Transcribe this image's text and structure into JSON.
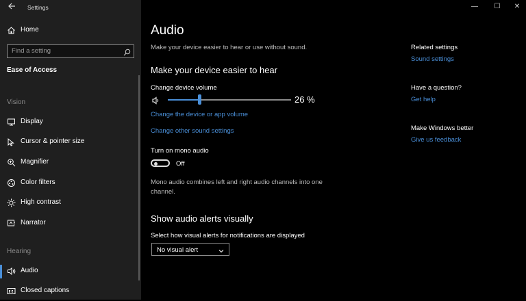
{
  "window": {
    "title": "Settings",
    "controls": {
      "minimize": "—",
      "maximize": "☐",
      "close": "✕"
    }
  },
  "sidebar": {
    "home_label": "Home",
    "search_placeholder": "Find a setting",
    "category_title": "Ease of Access",
    "sections": [
      {
        "heading": "Vision",
        "items": [
          {
            "label": "Display",
            "icon": "display-icon"
          },
          {
            "label": "Cursor & pointer size",
            "icon": "cursor-icon"
          },
          {
            "label": "Magnifier",
            "icon": "magnifier-icon"
          },
          {
            "label": "Color filters",
            "icon": "color-filters-icon"
          },
          {
            "label": "High contrast",
            "icon": "high-contrast-icon"
          },
          {
            "label": "Narrator",
            "icon": "narrator-icon"
          }
        ]
      },
      {
        "heading": "Hearing",
        "items": [
          {
            "label": "Audio",
            "icon": "speaker-icon",
            "active": true
          },
          {
            "label": "Closed captions",
            "icon": "closed-captions-icon"
          }
        ]
      }
    ]
  },
  "main": {
    "title": "Audio",
    "subtitle": "Make your device easier to hear or use without sound.",
    "hear_section": {
      "heading": "Make your device easier to hear",
      "volume_label": "Change device volume",
      "volume_percent": 26,
      "volume_text": "26 %",
      "link_app_volume": "Change the device or app volume",
      "link_sound_settings": "Change other sound settings",
      "mono_label": "Turn on mono audio",
      "mono_state": "Off",
      "mono_description": "Mono audio combines left and right audio channels into one channel."
    },
    "alerts_section": {
      "heading": "Show audio alerts visually",
      "select_label": "Select how visual alerts for notifications are displayed",
      "select_value": "No visual alert"
    }
  },
  "related": {
    "related_heading": "Related settings",
    "related_link": "Sound settings",
    "question_heading": "Have a question?",
    "question_link": "Get help",
    "better_heading": "Make Windows better",
    "better_link": "Give us feedback"
  },
  "colors": {
    "accent": "#4a8fd8",
    "sidebar_bg": "#1f1f1f",
    "main_bg": "#000000"
  }
}
